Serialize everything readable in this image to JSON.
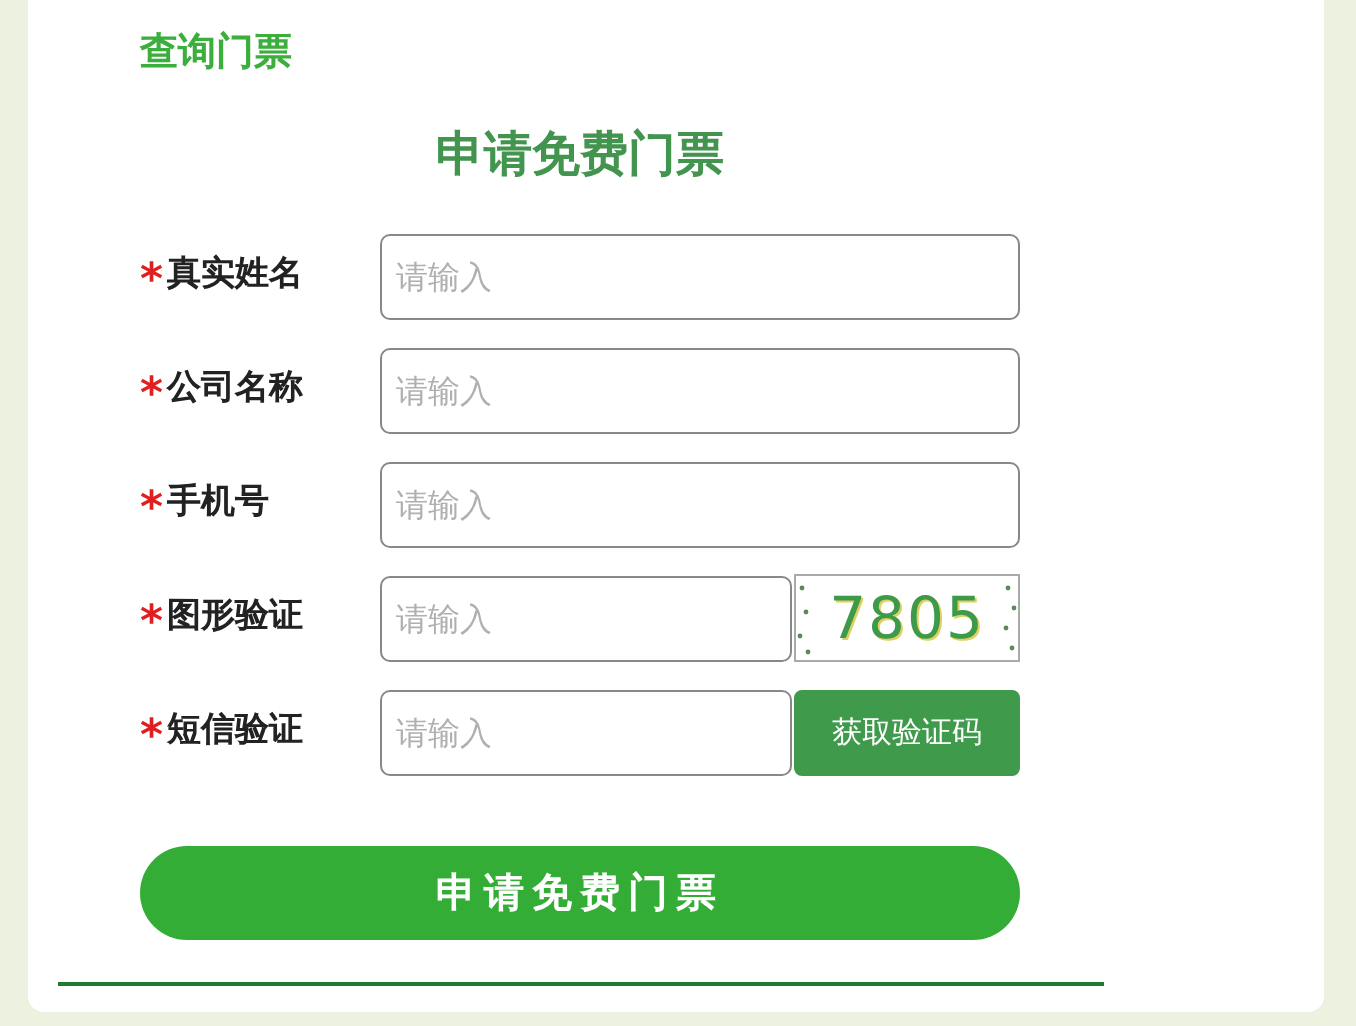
{
  "query_link": "查询门票",
  "title": "申请免费门票",
  "fields": [
    {
      "kind": "text",
      "required": "*",
      "label": "真实姓名",
      "placeholder": "请输入"
    },
    {
      "kind": "text",
      "required": "*",
      "label": "公司名称",
      "placeholder": "请输入"
    },
    {
      "kind": "text",
      "required": "*",
      "label": "手机号",
      "placeholder": "请输入"
    },
    {
      "kind": "captcha",
      "required": "*",
      "label": "图形验证",
      "placeholder": "请输入",
      "captcha": "7805"
    },
    {
      "kind": "sms",
      "required": "*",
      "label": "短信验证",
      "placeholder": "请输入",
      "button": "获取验证码"
    }
  ],
  "submit": "申请免费门票"
}
